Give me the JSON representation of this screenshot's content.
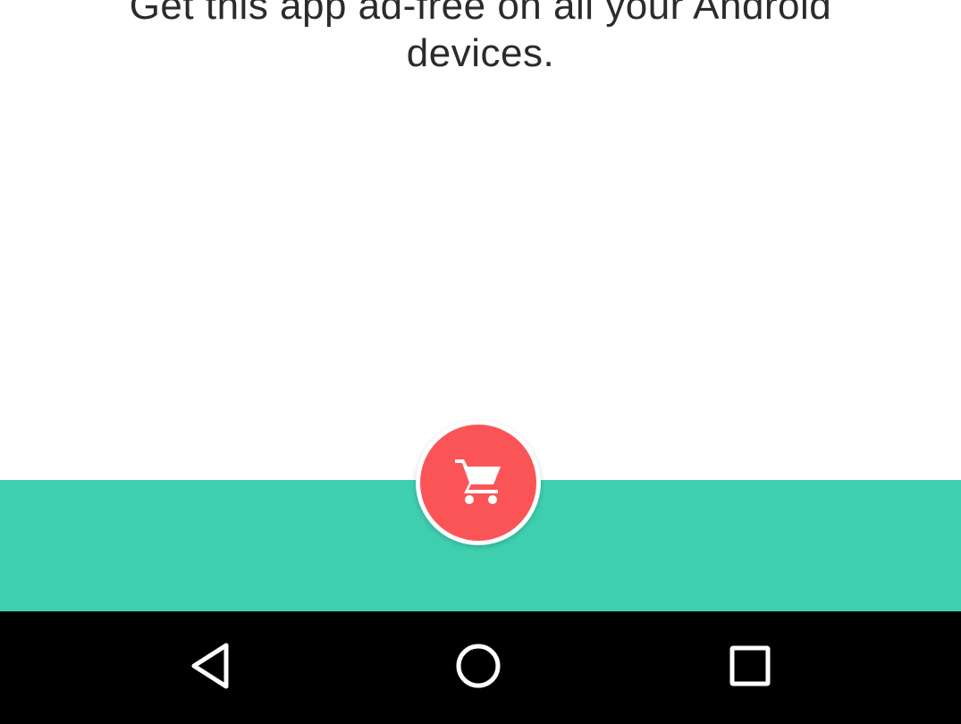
{
  "promo": {
    "line1": "Get this app ad-free on all your Android",
    "line2": "devices."
  },
  "buy_button": {
    "icon": "shopping-cart-icon"
  },
  "nav": {
    "back_icon": "back-triangle-icon",
    "home_icon": "home-circle-icon",
    "recents_icon": "recents-square-icon"
  },
  "colors": {
    "teal": "#3ecfaf",
    "fab_red": "#fb5457",
    "nav_bg": "#000000",
    "text": "#2b2b2b"
  }
}
